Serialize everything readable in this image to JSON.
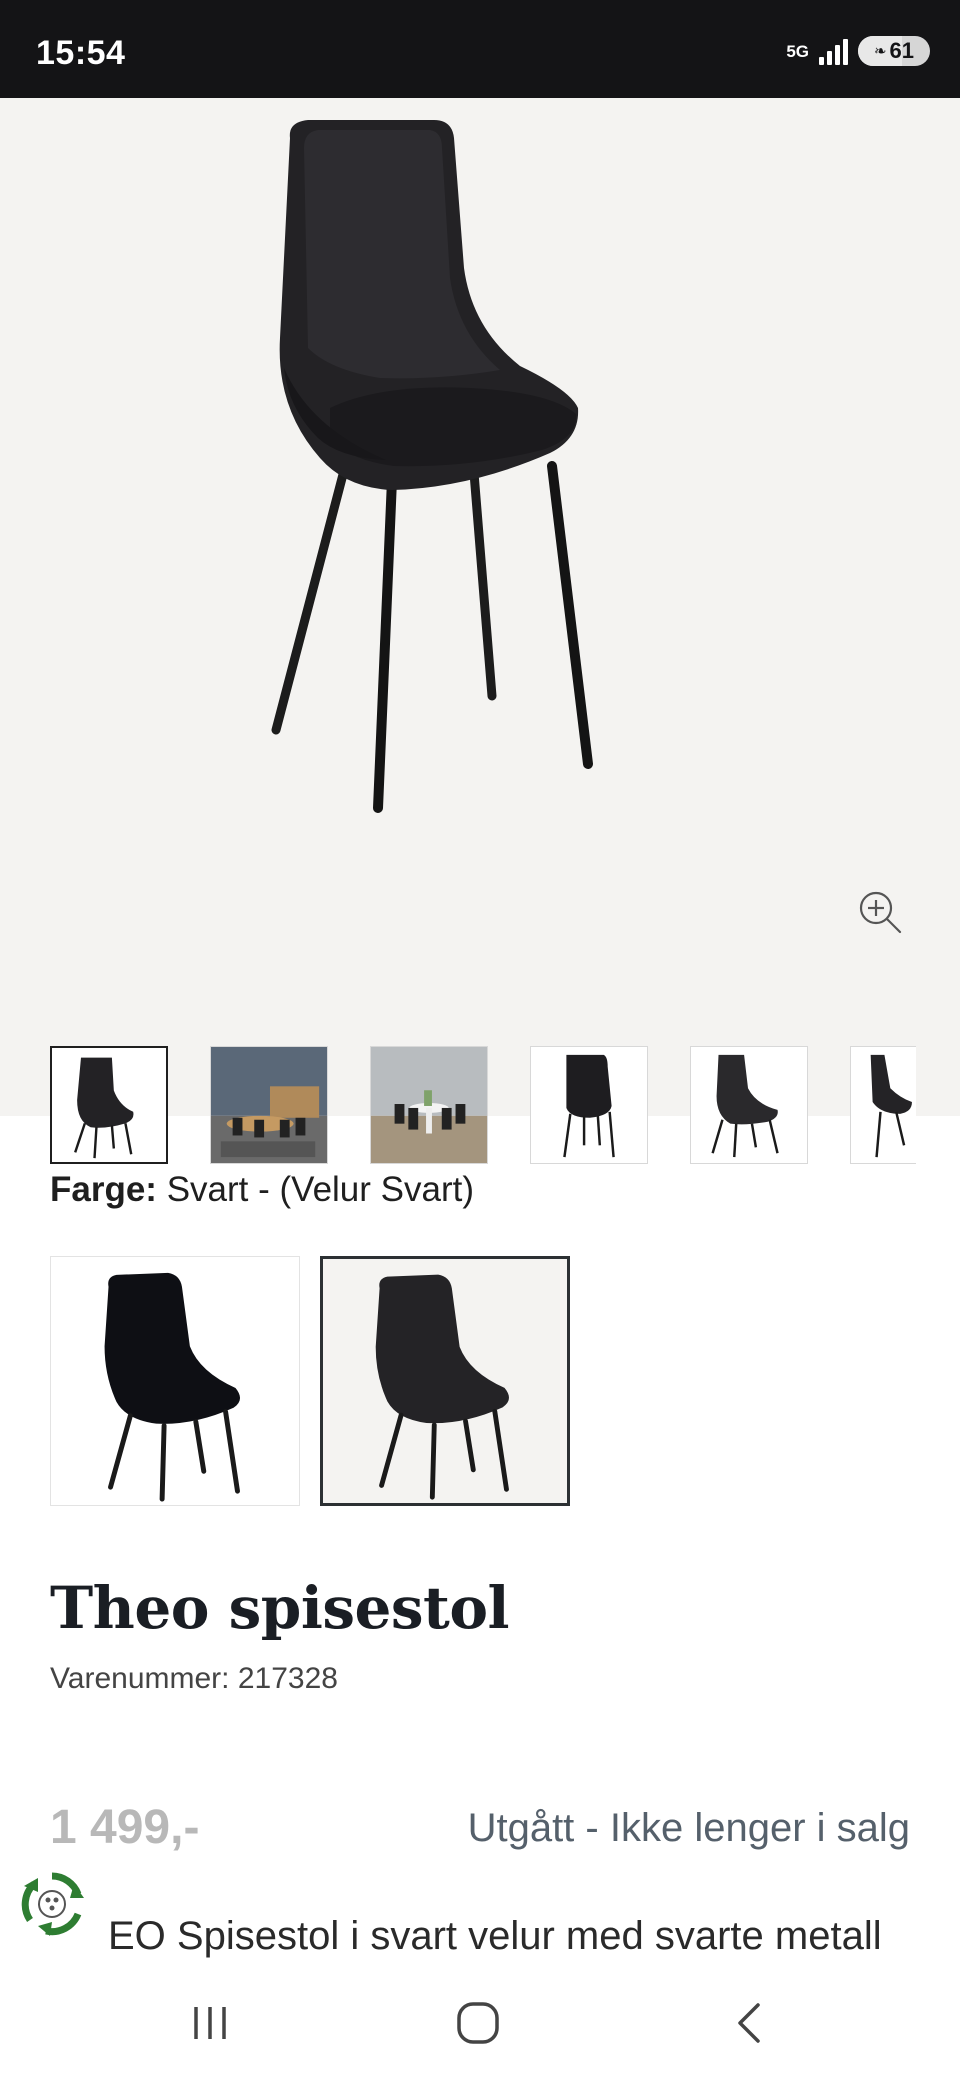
{
  "status": {
    "time": "15:54",
    "network": "5G",
    "battery": "61",
    "battery_level": 0.61
  },
  "gallery": {
    "thumbnails": [
      {
        "name": "thumb-chair-front"
      },
      {
        "name": "thumb-dining-room-1"
      },
      {
        "name": "thumb-dining-room-2"
      },
      {
        "name": "thumb-chair-straight"
      },
      {
        "name": "thumb-chair-angle"
      },
      {
        "name": "thumb-chair-side"
      }
    ],
    "active_index": 0
  },
  "color": {
    "label": "Farge:",
    "value": "Svart - (Velur Svart)",
    "selected_index": 1
  },
  "product": {
    "title": "Theo spisestol",
    "sku": "Varenummer: 217328",
    "price": "1 499,-",
    "availability": "Utgått - Ikke lenger i salg",
    "description": "EO Spisestol i svart velur med svarte metall"
  },
  "colors": {
    "status_bar_bg": "#141416",
    "gallery_bg": "#f4f3f1",
    "price_muted": "#b8b8b8",
    "availability_text": "#55606b",
    "badge_green": "#2e7d32"
  },
  "icons": {
    "zoom": "zoom-in-icon",
    "recycle": "recycle-badge-icon",
    "nav_recents": "recent-apps-icon",
    "nav_home": "home-icon",
    "nav_back": "back-icon"
  }
}
